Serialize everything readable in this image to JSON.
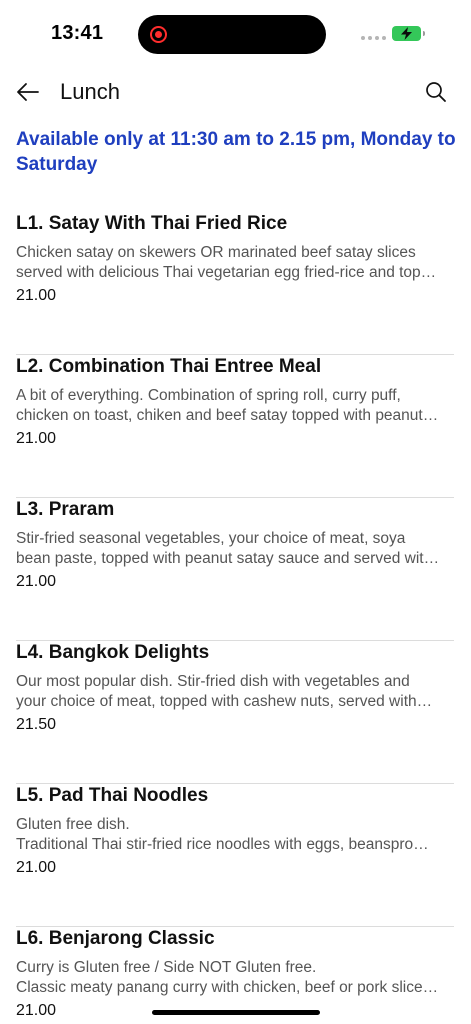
{
  "status_bar": {
    "time": "13:41",
    "battery_color": "#34c759",
    "recording_color": "#ff2d2d"
  },
  "header": {
    "title": "Lunch",
    "back_icon": "arrow-left-icon",
    "search_icon": "search-icon"
  },
  "notice": {
    "text": "Available only at 11:30 am to 2.15 pm,  Monday to Saturday",
    "color": "#1f3fbf"
  },
  "menu": {
    "items": [
      {
        "name": "L1. Satay With Thai Fried Rice",
        "desc_line1": "Chicken satay on skewers OR marinated beef satay slices",
        "desc_line2": "served with delicious Thai vegetarian egg fried-rice and top…",
        "price": "21.00"
      },
      {
        "name": "L2. Combination Thai Entree Meal",
        "desc_line1": "A bit of everything. Combination of spring roll, curry puff,",
        "desc_line2": "chicken on toast, chiken and beef satay topped with peanut…",
        "price": "21.00"
      },
      {
        "name": "L3. Praram",
        "desc_line1": "Stir-fried seasonal vegetables, your choice of meat, soya",
        "desc_line2": "bean paste, topped with peanut satay sauce and served wit…",
        "price": "21.00"
      },
      {
        "name": "L4. Bangkok Delights",
        "desc_line1": "Our most popular dish. Stir-fried dish with vegetables and",
        "desc_line2": "your choice of meat, topped with cashew nuts, served with…",
        "price": "21.50"
      },
      {
        "name": "L5. Pad Thai Noodles",
        "desc_line1": "Gluten free dish.",
        "desc_line2": "Traditional Thai stir-fried rice noodles with eggs, beanspro…",
        "price": "21.00"
      },
      {
        "name": "L6. Benjarong Classic",
        "desc_line1": "Curry is Gluten free  / Side NOT Gluten free.",
        "desc_line2": "Classic meaty panang curry with chicken, beef or pork slice…",
        "price": "21.00"
      }
    ]
  }
}
